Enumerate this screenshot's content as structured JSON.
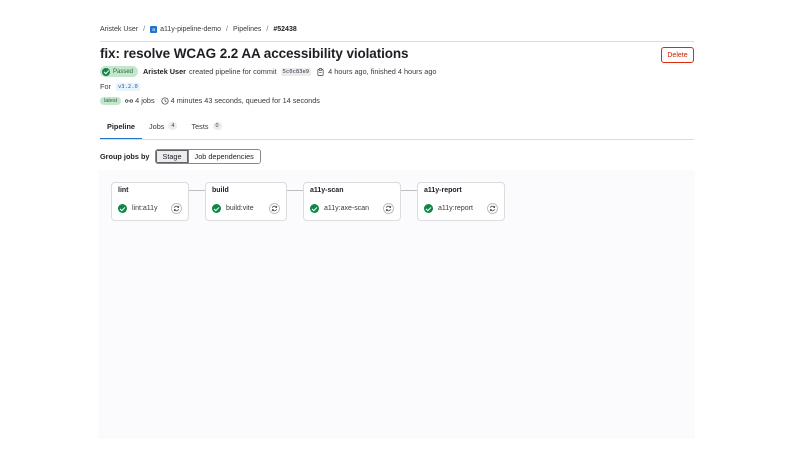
{
  "breadcrumb": {
    "user": "Aristek User",
    "project_avatar": "a",
    "project": "a11y-pipeline-demo",
    "section": "Pipelines",
    "current": "#52438",
    "separator": "/"
  },
  "pipeline": {
    "title": "fix: resolve WCAG 2.2 AA accessibility violations",
    "delete_label": "Delete",
    "status_label": "Passed",
    "author": "Aristek User",
    "created_text": "created pipeline for commit",
    "commit_sha": "5c0c83e9",
    "time_text": "4 hours ago, finished 4 hours ago",
    "for_label": "For",
    "ref": "v3.2.0",
    "latest_label": "latest",
    "jobs_text": "4 jobs",
    "duration_text": "4 minutes 43 seconds, queued for 14 seconds"
  },
  "tabs": [
    {
      "label": "Pipeline",
      "count": null
    },
    {
      "label": "Jobs",
      "count": "4"
    },
    {
      "label": "Tests",
      "count": "0"
    }
  ],
  "group_by": {
    "label": "Group jobs by",
    "options": [
      "Stage",
      "Job dependencies"
    ],
    "selected": "Stage"
  },
  "stages": [
    {
      "name": "lint",
      "job": "lint:a11y",
      "status": "success"
    },
    {
      "name": "build",
      "job": "build:vite",
      "status": "success"
    },
    {
      "name": "a11y-scan",
      "job": "a11y:axe-scan",
      "status": "success"
    },
    {
      "name": "a11y-report",
      "job": "a11y:report",
      "status": "success"
    }
  ],
  "colors": {
    "success": "#108548",
    "accent": "#1f75cb",
    "danger": "#dd2b0e"
  },
  "icons": {
    "status": "check-circle-icon",
    "copy": "copy-icon",
    "jobs": "pipeline-icon",
    "duration": "clock-icon",
    "retry": "retry-icon"
  }
}
